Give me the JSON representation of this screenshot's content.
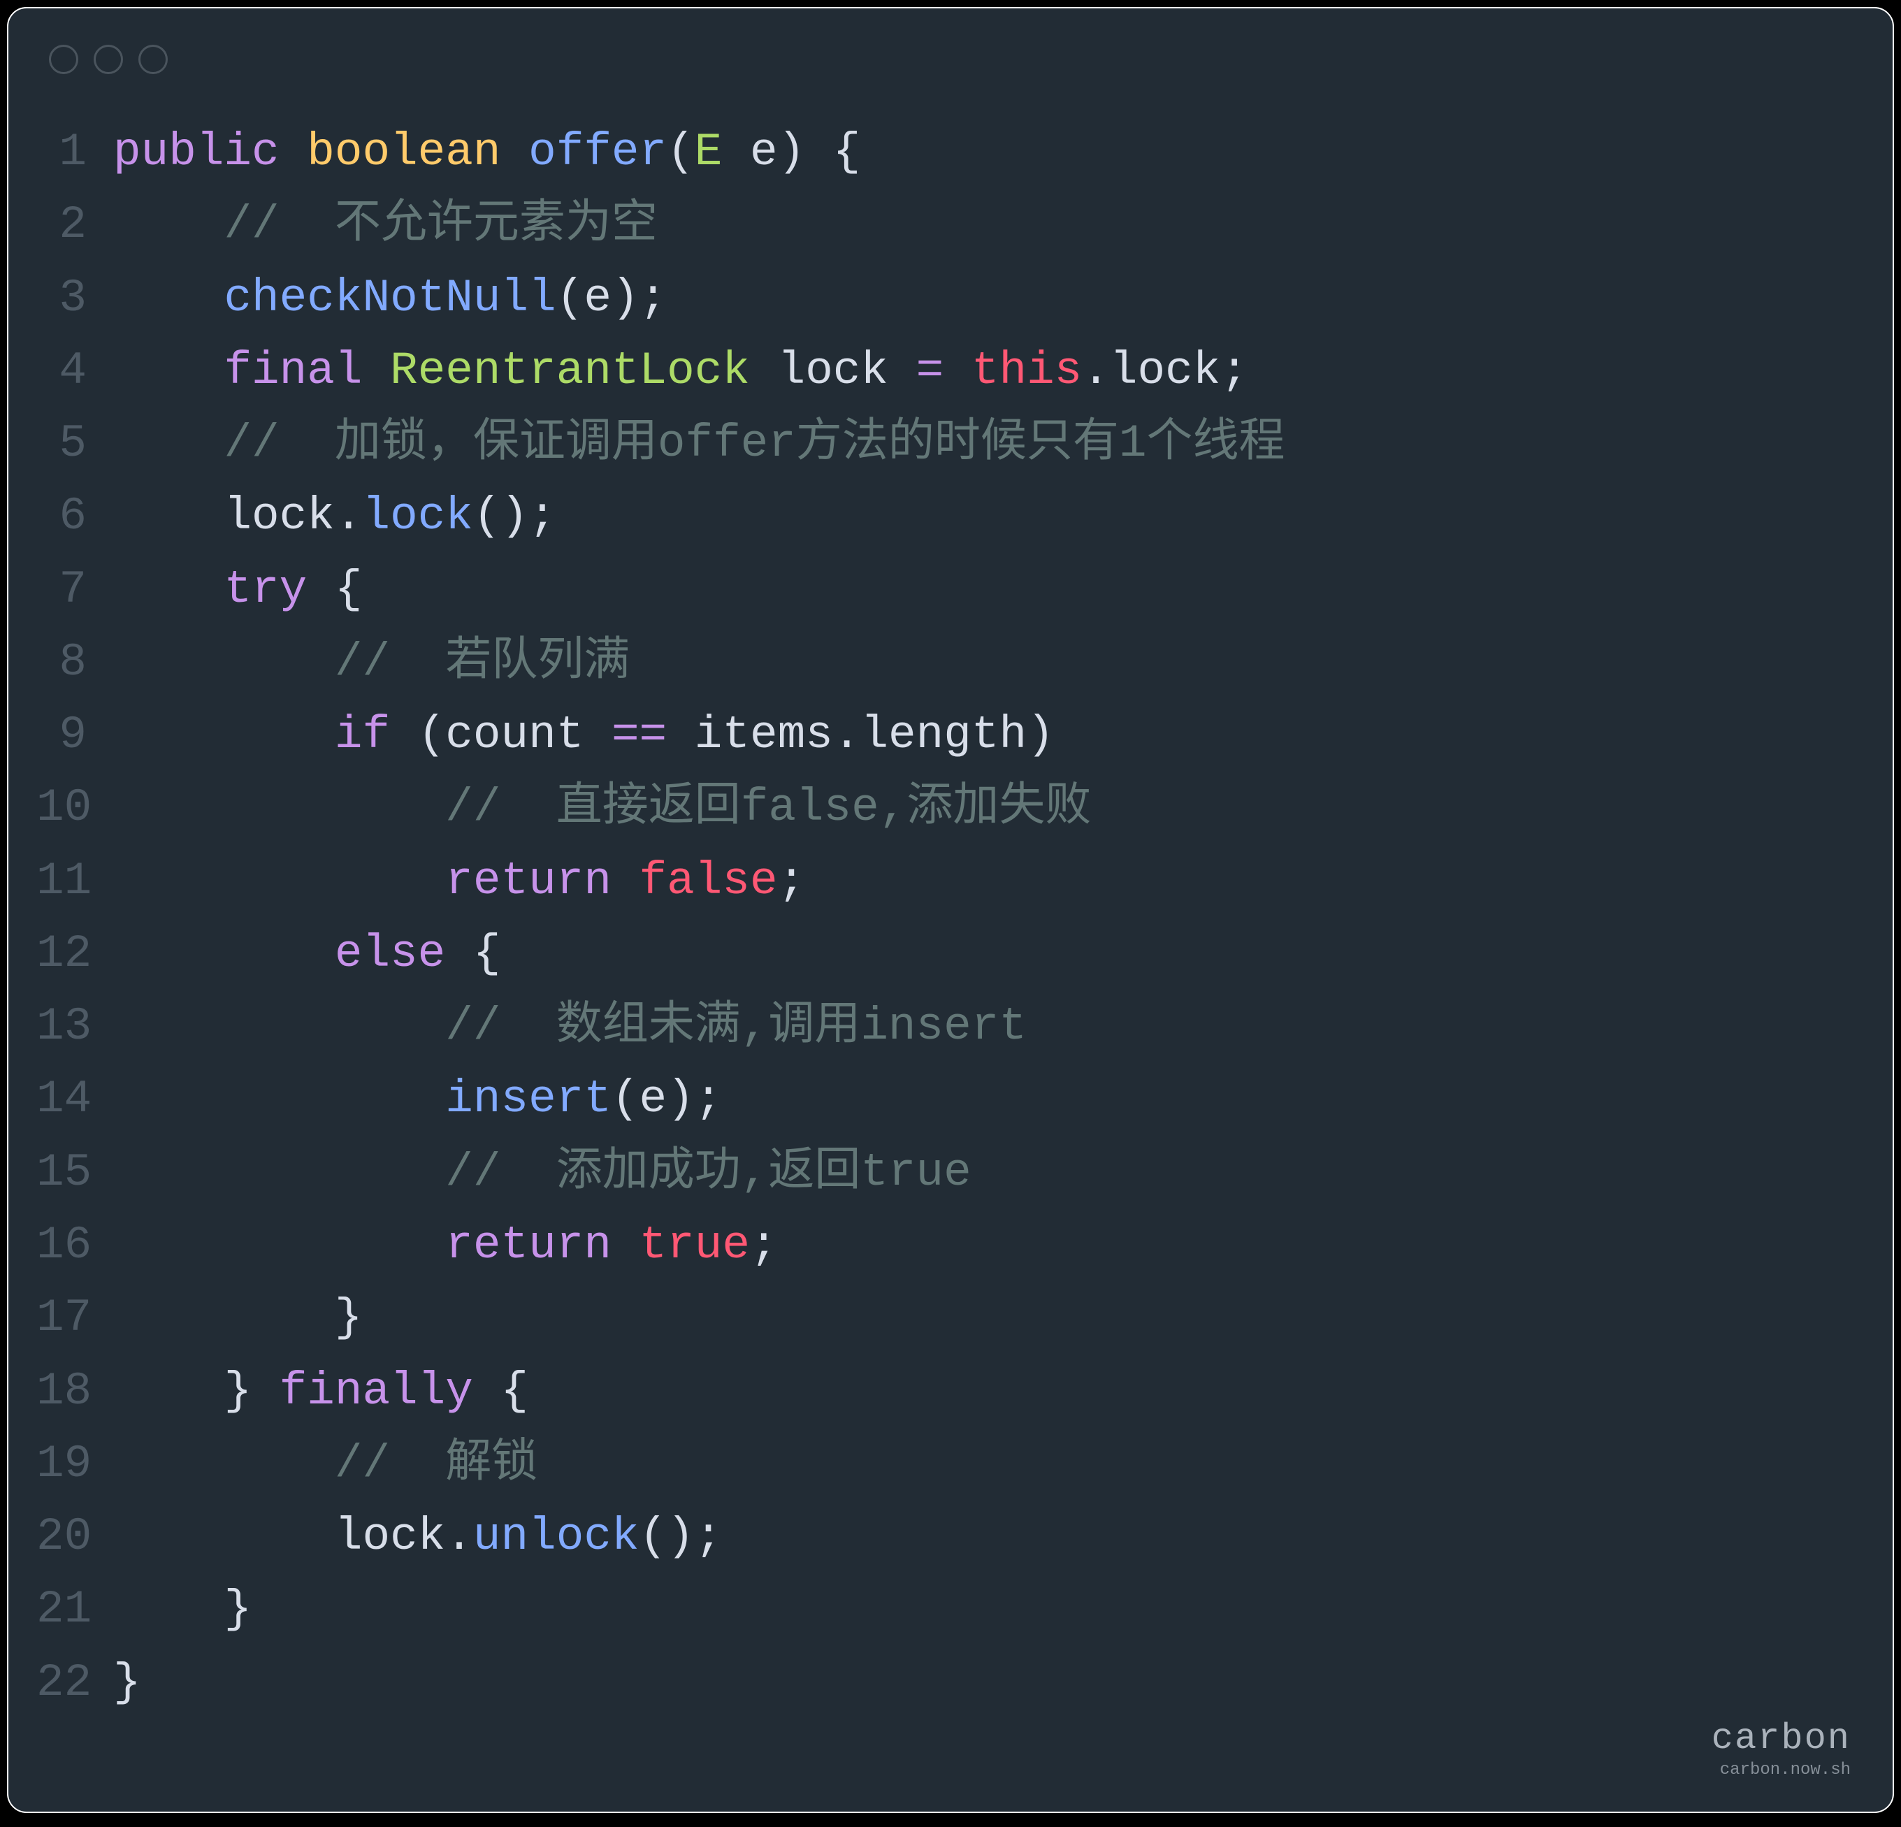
{
  "watermark": {
    "brand": "carbon",
    "url": "carbon.now.sh"
  },
  "lines": [
    {
      "n": "1",
      "tokens": [
        {
          "c": "kw-public",
          "t": "public"
        },
        {
          "c": "code",
          "t": " "
        },
        {
          "c": "kw-type",
          "t": "boolean"
        },
        {
          "c": "code",
          "t": " "
        },
        {
          "c": "fn",
          "t": "offer"
        },
        {
          "c": "punct",
          "t": "("
        },
        {
          "c": "cls",
          "t": "E"
        },
        {
          "c": "code",
          "t": " "
        },
        {
          "c": "ident",
          "t": "e"
        },
        {
          "c": "punct",
          "t": ") {"
        }
      ]
    },
    {
      "n": "2",
      "tokens": [
        {
          "c": "code",
          "t": "    "
        },
        {
          "c": "comment",
          "t": "//  不允许元素为空"
        }
      ]
    },
    {
      "n": "3",
      "tokens": [
        {
          "c": "code",
          "t": "    "
        },
        {
          "c": "fn",
          "t": "checkNotNull"
        },
        {
          "c": "punct",
          "t": "("
        },
        {
          "c": "ident",
          "t": "e"
        },
        {
          "c": "punct",
          "t": ");"
        }
      ]
    },
    {
      "n": "4",
      "tokens": [
        {
          "c": "code",
          "t": "    "
        },
        {
          "c": "kw-final",
          "t": "final"
        },
        {
          "c": "code",
          "t": " "
        },
        {
          "c": "cls",
          "t": "ReentrantLock"
        },
        {
          "c": "code",
          "t": " "
        },
        {
          "c": "ident",
          "t": "lock"
        },
        {
          "c": "code",
          "t": " "
        },
        {
          "c": "op",
          "t": "="
        },
        {
          "c": "code",
          "t": " "
        },
        {
          "c": "kw-this",
          "t": "this"
        },
        {
          "c": "punct",
          "t": "."
        },
        {
          "c": "ident",
          "t": "lock"
        },
        {
          "c": "punct",
          "t": ";"
        }
      ]
    },
    {
      "n": "5",
      "tokens": [
        {
          "c": "code",
          "t": "    "
        },
        {
          "c": "comment",
          "t": "//  加锁，保证调用offer方法的时候只有1个线程"
        }
      ]
    },
    {
      "n": "6",
      "tokens": [
        {
          "c": "code",
          "t": "    "
        },
        {
          "c": "ident",
          "t": "lock"
        },
        {
          "c": "punct",
          "t": "."
        },
        {
          "c": "fn",
          "t": "lock"
        },
        {
          "c": "punct",
          "t": "();"
        }
      ]
    },
    {
      "n": "7",
      "tokens": [
        {
          "c": "code",
          "t": "    "
        },
        {
          "c": "kw-try",
          "t": "try"
        },
        {
          "c": "code",
          "t": " "
        },
        {
          "c": "punct",
          "t": "{"
        }
      ]
    },
    {
      "n": "8",
      "tokens": [
        {
          "c": "code",
          "t": "        "
        },
        {
          "c": "comment",
          "t": "//  若队列满"
        }
      ]
    },
    {
      "n": "9",
      "tokens": [
        {
          "c": "code",
          "t": "        "
        },
        {
          "c": "kw-if",
          "t": "if"
        },
        {
          "c": "code",
          "t": " "
        },
        {
          "c": "punct",
          "t": "("
        },
        {
          "c": "ident",
          "t": "count"
        },
        {
          "c": "code",
          "t": " "
        },
        {
          "c": "op",
          "t": "=="
        },
        {
          "c": "code",
          "t": " "
        },
        {
          "c": "ident",
          "t": "items"
        },
        {
          "c": "punct",
          "t": "."
        },
        {
          "c": "ident",
          "t": "length"
        },
        {
          "c": "punct",
          "t": ")"
        }
      ]
    },
    {
      "n": "10",
      "tokens": [
        {
          "c": "code",
          "t": "            "
        },
        {
          "c": "comment",
          "t": "//  直接返回false,添加失败"
        }
      ]
    },
    {
      "n": "11",
      "tokens": [
        {
          "c": "code",
          "t": "            "
        },
        {
          "c": "kw-return",
          "t": "return"
        },
        {
          "c": "code",
          "t": " "
        },
        {
          "c": "kw-bool",
          "t": "false"
        },
        {
          "c": "punct",
          "t": ";"
        }
      ]
    },
    {
      "n": "12",
      "tokens": [
        {
          "c": "code",
          "t": "        "
        },
        {
          "c": "kw-else",
          "t": "else"
        },
        {
          "c": "code",
          "t": " "
        },
        {
          "c": "punct",
          "t": "{"
        }
      ]
    },
    {
      "n": "13",
      "tokens": [
        {
          "c": "code",
          "t": "            "
        },
        {
          "c": "comment",
          "t": "//  数组未满,调用insert"
        }
      ]
    },
    {
      "n": "14",
      "tokens": [
        {
          "c": "code",
          "t": "            "
        },
        {
          "c": "fn",
          "t": "insert"
        },
        {
          "c": "punct",
          "t": "("
        },
        {
          "c": "ident",
          "t": "e"
        },
        {
          "c": "punct",
          "t": ");"
        }
      ]
    },
    {
      "n": "15",
      "tokens": [
        {
          "c": "code",
          "t": "            "
        },
        {
          "c": "comment",
          "t": "//  添加成功,返回true"
        }
      ]
    },
    {
      "n": "16",
      "tokens": [
        {
          "c": "code",
          "t": "            "
        },
        {
          "c": "kw-return",
          "t": "return"
        },
        {
          "c": "code",
          "t": " "
        },
        {
          "c": "kw-bool",
          "t": "true"
        },
        {
          "c": "punct",
          "t": ";"
        }
      ]
    },
    {
      "n": "17",
      "tokens": [
        {
          "c": "code",
          "t": "        "
        },
        {
          "c": "punct",
          "t": "}"
        }
      ]
    },
    {
      "n": "18",
      "tokens": [
        {
          "c": "code",
          "t": "    "
        },
        {
          "c": "punct",
          "t": "}"
        },
        {
          "c": "code",
          "t": " "
        },
        {
          "c": "kw-finally",
          "t": "finally"
        },
        {
          "c": "code",
          "t": " "
        },
        {
          "c": "punct",
          "t": "{"
        }
      ]
    },
    {
      "n": "19",
      "tokens": [
        {
          "c": "code",
          "t": "        "
        },
        {
          "c": "comment",
          "t": "//  解锁"
        }
      ]
    },
    {
      "n": "20",
      "tokens": [
        {
          "c": "code",
          "t": "        "
        },
        {
          "c": "ident",
          "t": "lock"
        },
        {
          "c": "punct",
          "t": "."
        },
        {
          "c": "fn",
          "t": "unlock"
        },
        {
          "c": "punct",
          "t": "();"
        }
      ]
    },
    {
      "n": "21",
      "tokens": [
        {
          "c": "code",
          "t": "    "
        },
        {
          "c": "punct",
          "t": "}"
        }
      ]
    },
    {
      "n": "22",
      "tokens": [
        {
          "c": "punct",
          "t": "}"
        }
      ]
    }
  ]
}
